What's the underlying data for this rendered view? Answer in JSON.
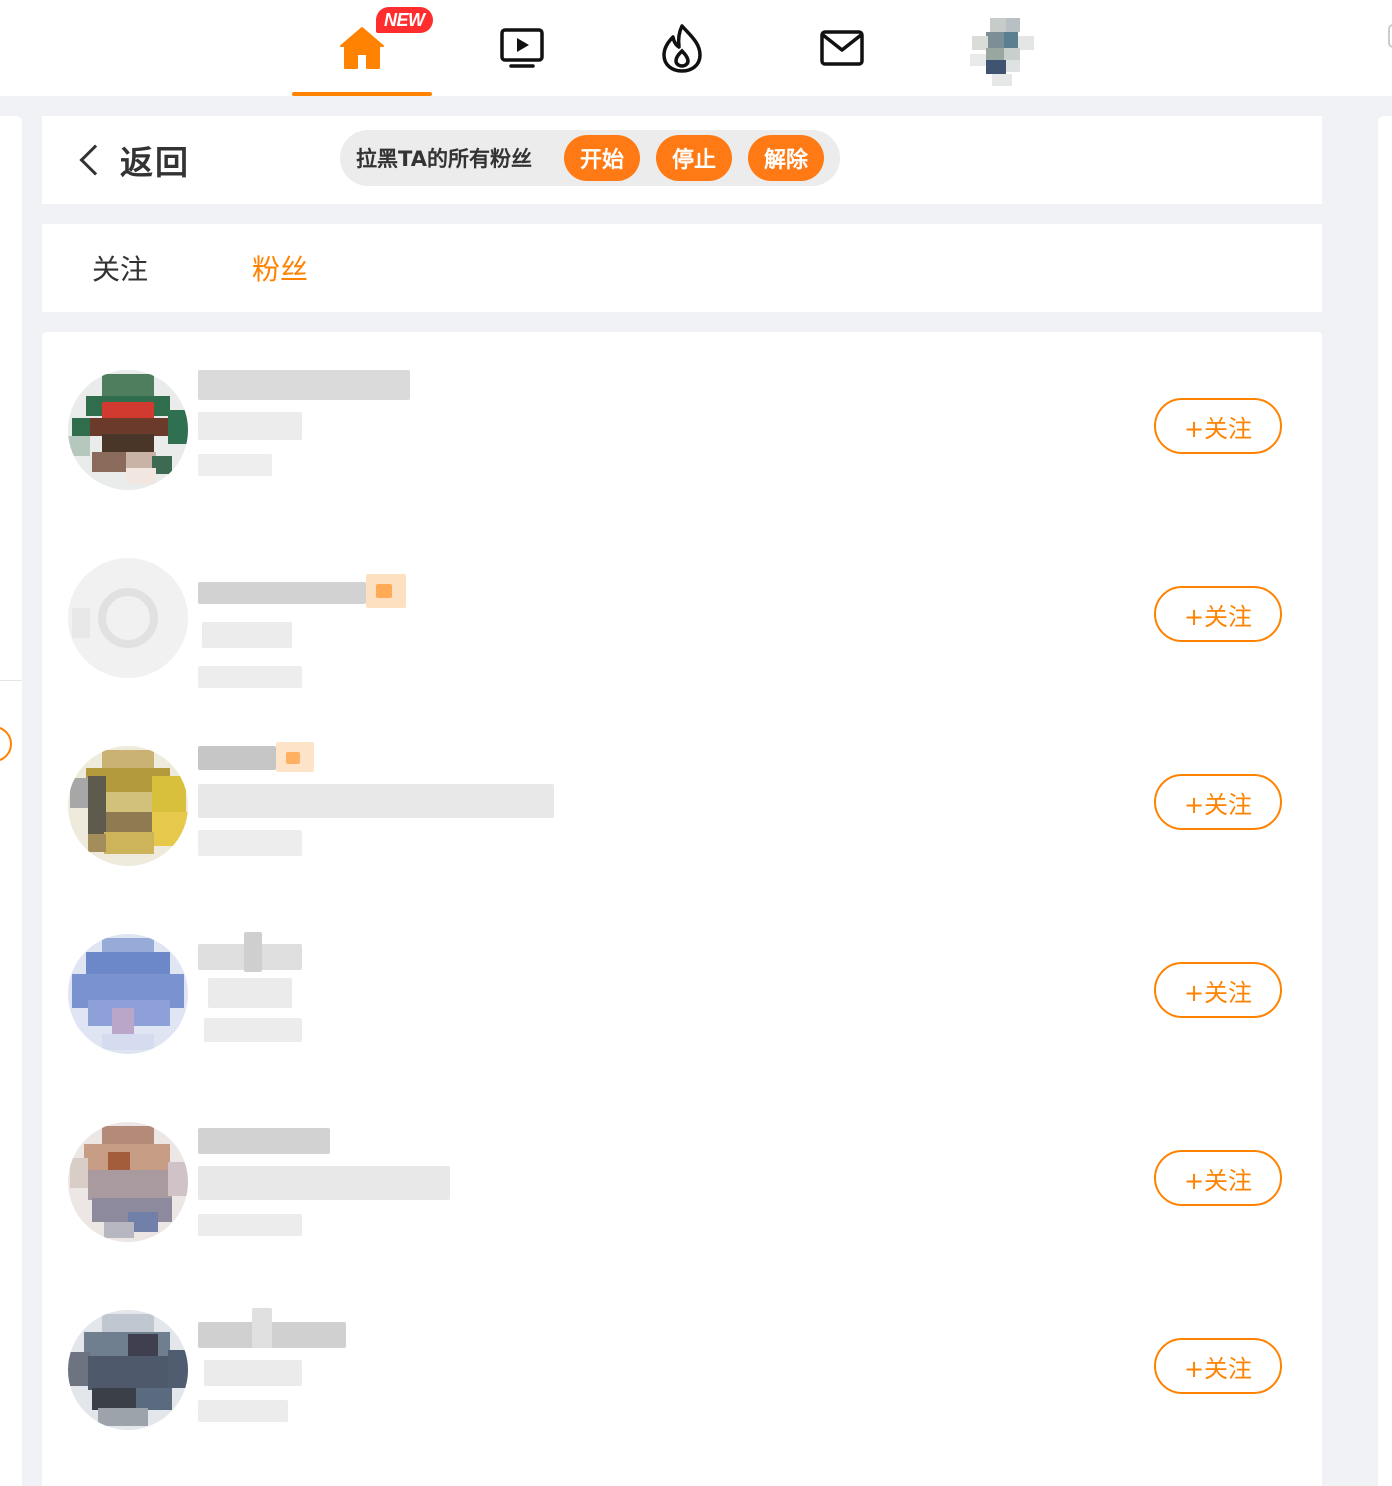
{
  "topnav": {
    "items": [
      {
        "name": "home",
        "icon": "home-icon",
        "active": true
      },
      {
        "name": "video",
        "icon": "video-icon"
      },
      {
        "name": "hot",
        "icon": "fire-icon"
      },
      {
        "name": "messages",
        "icon": "mail-icon"
      },
      {
        "name": "profile",
        "icon": "avatar"
      }
    ],
    "new_badge": "NEW",
    "accent_color": "#ff8200"
  },
  "header": {
    "back_label": "返回",
    "block_label": "拉黑TA的所有粉丝",
    "start_label": "开始",
    "stop_label": "停止",
    "remove_label": "解除"
  },
  "tabs": {
    "follow_label": "关注",
    "fans_label": "粉丝",
    "active": "fans"
  },
  "fans": [
    {
      "follow_label": "+关注"
    },
    {
      "follow_label": "+关注"
    },
    {
      "follow_label": "+关注"
    },
    {
      "follow_label": "+关注"
    },
    {
      "follow_label": "+关注"
    },
    {
      "follow_label": "+关注"
    }
  ]
}
